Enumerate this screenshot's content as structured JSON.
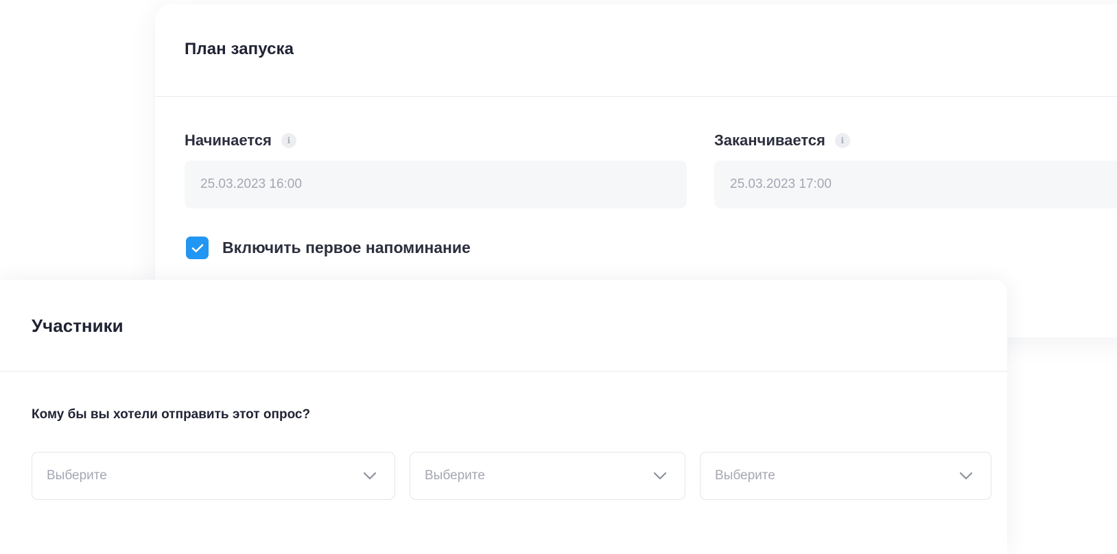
{
  "launch_plan": {
    "title": "План запуска",
    "start": {
      "label": "Начинается",
      "value": "25.03.2023 16:00",
      "info_icon": "info-icon"
    },
    "end": {
      "label": "Заканчивается",
      "value": "25.03.2023 17:00",
      "info_icon": "info-icon"
    },
    "reminder": {
      "label": "Включить первое напоминание",
      "checked": true
    }
  },
  "participants": {
    "title": "Участники",
    "question": "Кому бы вы хотели отправить этот опрос?",
    "selects": [
      {
        "placeholder": "Выберите",
        "icon": "chevron-down-icon"
      },
      {
        "placeholder": "Выберите",
        "icon": "chevron-down-icon"
      },
      {
        "placeholder": "Выберите",
        "icon": "chevron-down-icon"
      }
    ]
  },
  "colors": {
    "accent": "#2196f3",
    "text_dark": "#1f2233",
    "text_muted": "#a3a7b3",
    "input_bg": "#f6f7f9",
    "border": "#e3e5ea"
  }
}
